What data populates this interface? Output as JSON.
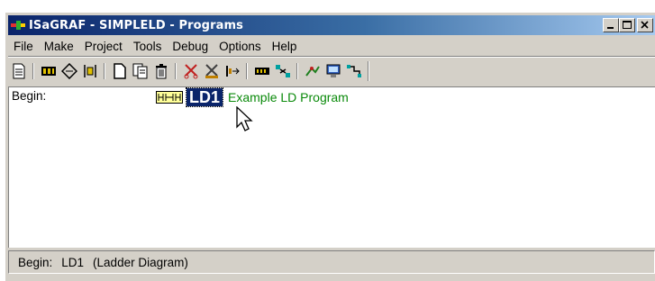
{
  "window": {
    "title": "ISaGRAF - SIMPLELD - Programs",
    "controls": [
      "minimize",
      "maximize",
      "close"
    ]
  },
  "menu": [
    "File",
    "Make",
    "Project",
    "Tools",
    "Debug",
    "Options",
    "Help"
  ],
  "toolbar": {
    "buttons": [
      "document-icon",
      "io-connection-icon",
      "dictionary-icon",
      "variables-icon",
      "new-program-icon",
      "copy-program-icon",
      "delete-program-icon",
      "cut-icon",
      "compile-icon",
      "verify-icon",
      "library-icon",
      "cross-reference-icon",
      "simulate-icon",
      "debug-icon",
      "download-icon"
    ]
  },
  "programs": {
    "section_label": "Begin:",
    "items": [
      {
        "name": "LD1",
        "description": "Example LD Program",
        "language_icon_label": "HHH"
      }
    ]
  },
  "status": {
    "section": "Begin:",
    "program": "LD1",
    "type": "(Ladder Diagram)"
  },
  "colors": {
    "title_start": "#0a246a",
    "title_end": "#a6caf0",
    "selection": "#0a246a",
    "description_text": "#0a8a0a",
    "face": "#d4d0c8"
  }
}
